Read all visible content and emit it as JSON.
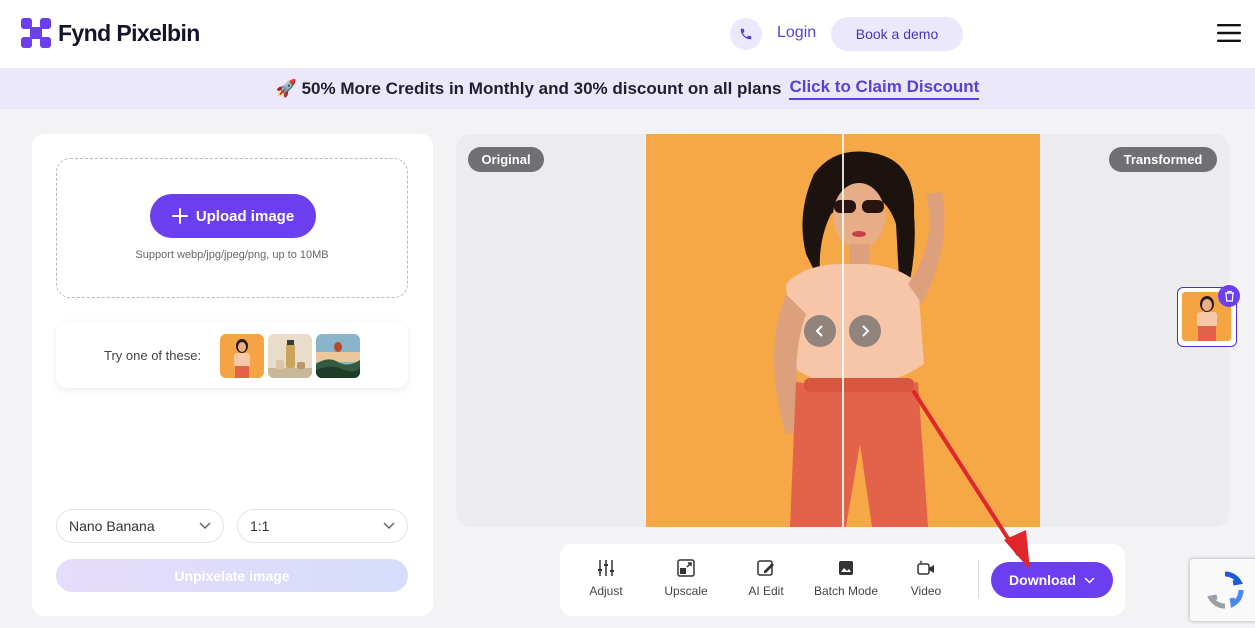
{
  "header": {
    "logo_text": "Fynd Pixelbin",
    "login_label": "Login",
    "demo_label": "Book a demo",
    "brand_color": "#6b3ff0"
  },
  "promo": {
    "message": "🚀 50% More Credits in Monthly and 30% discount on all plans",
    "cta_label": "Click to Claim Discount"
  },
  "upload": {
    "button_label": "Upload image",
    "support_text": "Support webp/jpg/jpeg/png, up to 10MB"
  },
  "samples": {
    "label": "Try one of these:",
    "items": [
      "woman-portrait",
      "cosmetic-product",
      "hot-air-balloon-landscape"
    ]
  },
  "controls": {
    "model_value": "Nano Banana",
    "ratio_value": "1:1",
    "action_label": "Unpixelate image"
  },
  "preview": {
    "original_tag": "Original",
    "transformed_tag": "Transformed"
  },
  "toolbar": {
    "tools": [
      "Adjust",
      "Upscale",
      "AI Edit",
      "Batch Mode",
      "Video"
    ],
    "download_label": "Download"
  },
  "icons": [
    "phone-icon",
    "menu-icon",
    "plus-icon",
    "chevron-down-icon",
    "chevron-left-icon",
    "chevron-right-icon",
    "trash-icon",
    "adjust-icon",
    "upscale-icon",
    "ai-edit-icon",
    "batch-mode-icon",
    "video-icon",
    "recaptcha-icon"
  ]
}
